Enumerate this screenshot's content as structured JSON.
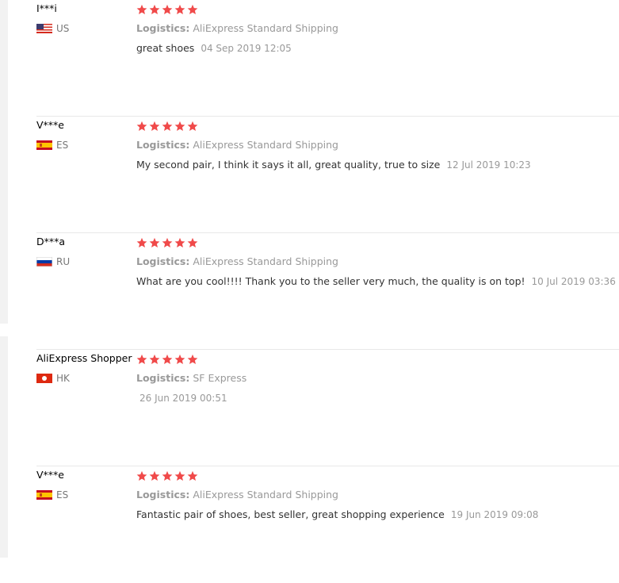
{
  "reviews": [
    {
      "user": "I***i",
      "country": "US",
      "flag_icon": "us-flag-icon",
      "rating": 5,
      "logistics_label": "Logistics:",
      "logistics_value": "AliExpress Standard Shipping",
      "comment": "great shoes",
      "date": "04 Sep 2019 12:05"
    },
    {
      "user": "V***e",
      "country": "ES",
      "flag_icon": "es-flag-icon",
      "rating": 5,
      "logistics_label": "Logistics:",
      "logistics_value": "AliExpress Standard Shipping",
      "comment": "My second pair, I think it says it all, great quality, true to size",
      "date": "12 Jul 2019 10:23"
    },
    {
      "user": "D***a",
      "country": "RU",
      "flag_icon": "ru-flag-icon",
      "rating": 5,
      "logistics_label": "Logistics:",
      "logistics_value": "AliExpress Standard Shipping",
      "comment": "What are you cool!!!! Thank you to the seller very much, the quality is on top!",
      "date": "10 Jul 2019 03:36"
    },
    {
      "user": "AliExpress Shopper",
      "country": "HK",
      "flag_icon": "hk-flag-icon",
      "rating": 5,
      "logistics_label": "Logistics:",
      "logistics_value": "SF Express",
      "comment": "",
      "date": "26 Jun 2019 00:51"
    },
    {
      "user": "V***e",
      "country": "ES",
      "flag_icon": "es-flag-icon",
      "rating": 5,
      "logistics_label": "Logistics:",
      "logistics_value": "AliExpress Standard Shipping",
      "comment": "Fantastic pair of shoes, best seller, great shopping experience",
      "date": "19 Jun 2019 09:08"
    }
  ],
  "colors": {
    "star": "#f04a4a",
    "muted_text": "#999999",
    "body_text": "#333333",
    "divider": "#e8e8e8"
  }
}
